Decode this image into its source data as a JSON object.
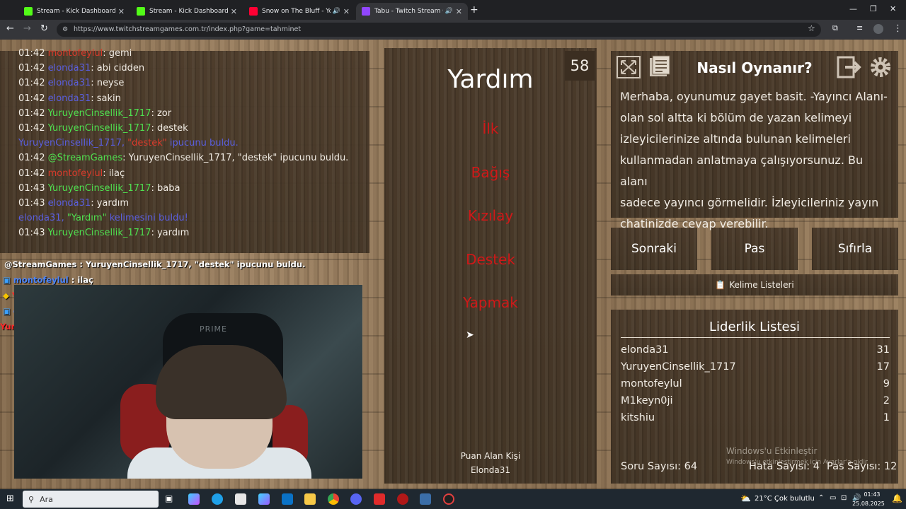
{
  "browser": {
    "tabs": [
      {
        "title": "Stream - Kick Dashboard",
        "color": "#53fc18",
        "active": false
      },
      {
        "title": "Stream - Kick Dashboard",
        "color": "#53fc18",
        "active": false
      },
      {
        "title": "Snow on The Bluff - YouTub",
        "color": "#ff0033",
        "active": false
      },
      {
        "title": "Tabu - Twitch Stream Game",
        "color": "#9146ff",
        "active": true
      }
    ],
    "url": "https://www.twitchstreamgames.com.tr/index.php?game=tahminet"
  },
  "chat": [
    {
      "time": "01:42",
      "user": "montofeylul",
      "color": "#d93a2b",
      "text": ": gemi"
    },
    {
      "time": "01:42",
      "user": "elonda31",
      "color": "#5a5fe0",
      "text": ": abi cidden"
    },
    {
      "time": "01:42",
      "user": "elonda31",
      "color": "#5a5fe0",
      "text": ": neyse"
    },
    {
      "time": "01:42",
      "user": "elonda31",
      "color": "#5a5fe0",
      "text": ": sakin"
    },
    {
      "time": "01:42",
      "user": "YuruyenCinsellik_1717",
      "color": "#4fe04f",
      "text": ": zor"
    },
    {
      "time": "01:42",
      "user": "YuruyenCinsellik_1717",
      "color": "#4fe04f",
      "text": ": destek"
    },
    {
      "time": "",
      "user": "YuruyenCinsellik_1717, ",
      "color": "#5a5fe0",
      "text": "ipucunu buldu.",
      "highlight": "\"destek\"",
      "system": true
    },
    {
      "time": "01:42",
      "user": "@StreamGames",
      "color": "#4fe04f",
      "text": ": YuruyenCinsellik_1717, \"destek\" ipucunu buldu."
    },
    {
      "time": "01:42",
      "user": "montofeylul",
      "color": "#d93a2b",
      "text": ": ilaç"
    },
    {
      "time": "01:43",
      "user": "YuruyenCinsellik_1717",
      "color": "#4fe04f",
      "text": ": baba"
    },
    {
      "time": "01:43",
      "user": "elonda31",
      "color": "#5a5fe0",
      "text": ": yardım"
    },
    {
      "time": "",
      "user": "elonda31, ",
      "color": "#5a5fe0",
      "text": "kelimesini buldu!",
      "highlight": "\"Yardım\"",
      "system": true
    },
    {
      "time": "01:43",
      "user": "YuruyenCinsellik_1717",
      "color": "#4fe04f",
      "text": ": yardım"
    }
  ],
  "overlay_chat": [
    {
      "user": "@StreamGames",
      "color": "#ffffff",
      "text": " : YuruyenCinsellik_1717, \"destek\" ipucunu buldu."
    },
    {
      "user": "montofeylul",
      "color": "#4b86ff",
      "text": " : ilaç"
    },
    {
      "user": "YuruyenCinsellik_1717",
      "color": "#ff2a2a",
      "text": " : baba"
    },
    {
      "user": "elonda31",
      "color": "#4b86ff",
      "text": " : yardım"
    },
    {
      "user": "YuruyenCinsellik_1717",
      "color": "#ff2a2a",
      "text": " : yardım"
    }
  ],
  "webcam": {
    "brand": "PRIME"
  },
  "game": {
    "timer": "58",
    "word": "Yardım",
    "taboo_words": [
      "İlk",
      "Bağış",
      "Kızılay",
      "Destek",
      "Yapmak"
    ],
    "scorer_label": "Puan Alan Kişi",
    "scorer": "Elonda31"
  },
  "howto": {
    "title": "Nasıl Oynanır?",
    "lines": [
      "Merhaba, oyunumuz gayet basit. -Yayıncı Alanı-",
      "olan sol altta ki bölüm de yazan kelimeyi",
      "izleyicilerinize altında bulunan kelimeleri",
      "kullanmadan anlatmaya çalışıyorsunuz. Bu alanı",
      "sadece yayıncı görmelidir. İzleyicileriniz yayın",
      "chatinizde cevap verebilir."
    ]
  },
  "buttons": {
    "next": "Sonraki",
    "pass": "Pas",
    "reset": "Sıfırla",
    "word_lists": "Kelime Listeleri"
  },
  "leaderboard": {
    "title": "Liderlik Listesi",
    "rows": [
      {
        "name": "elonda31",
        "score": "31"
      },
      {
        "name": "YuruyenCinsellik_1717",
        "score": "17"
      },
      {
        "name": "montofeylul",
        "score": "9"
      },
      {
        "name": "M1keyn0ji",
        "score": "2"
      },
      {
        "name": "kitshiu",
        "score": "1"
      }
    ],
    "question_count": "Soru Sayısı: 64",
    "error_count": "Hata Sayısı: 4",
    "pass_count": "Pas Sayısı: 12"
  },
  "watermark": {
    "title": "Windows'u Etkinleştir",
    "subtitle": "Windows'u etkinleştirmek için Ayarlar'a gidin."
  },
  "taskbar": {
    "search": "Ara",
    "weather": "21°C  Çok bulutlu",
    "time": "01:43",
    "date": "25.08.2025"
  }
}
